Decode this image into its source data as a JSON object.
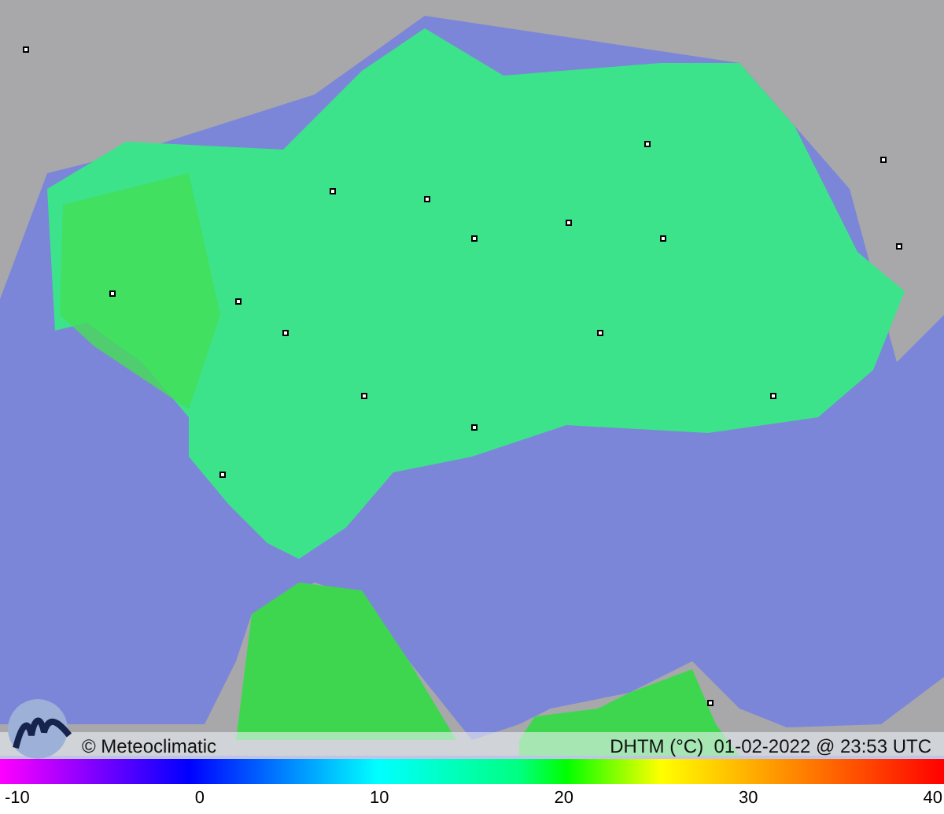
{
  "map": {
    "credit": "© Meteoclimatic",
    "caption": "DHTM (°C)  01-02-2022 @ 23:53 UTC"
  },
  "legend": {
    "ticks": [
      "-10",
      "0",
      "10",
      "20",
      "30",
      "40"
    ]
  }
}
